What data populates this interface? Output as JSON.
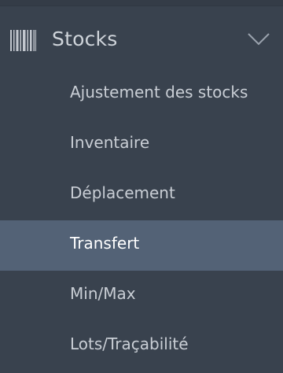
{
  "section": {
    "title": "Stocks",
    "icon": "barcode-icon",
    "expand_icon": "chevron-down-icon"
  },
  "menu": {
    "items": [
      {
        "label": "Ajustement des stocks",
        "active": false
      },
      {
        "label": "Inventaire",
        "active": false
      },
      {
        "label": "Déplacement",
        "active": false
      },
      {
        "label": "Transfert",
        "active": true
      },
      {
        "label": "Min/Max",
        "active": false
      },
      {
        "label": "Lots/Traçabilité",
        "active": false
      }
    ]
  },
  "colors": {
    "background": "#39424e",
    "active_background": "#536276",
    "text": "#c9ced5",
    "active_text": "#ffffff"
  }
}
